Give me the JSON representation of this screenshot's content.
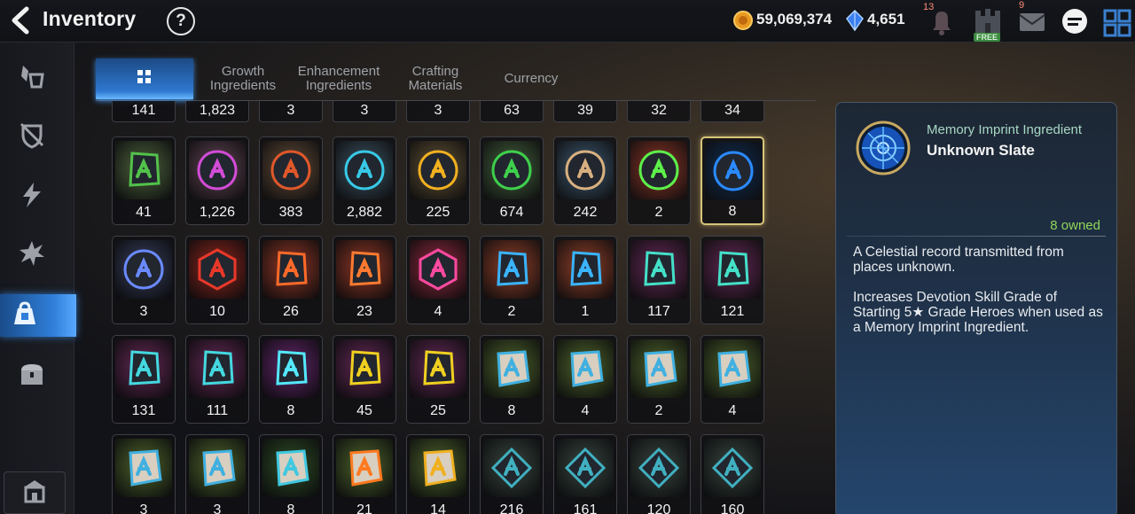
{
  "header": {
    "title": "Inventory",
    "help_icon": "question-mark-icon",
    "gold": "59,069,374",
    "crystals": "4,651",
    "notification_badge": "13",
    "mail_badge": "9",
    "free_label": "FREE"
  },
  "sidebar": {
    "items": [
      {
        "icon": "equipment-icon"
      },
      {
        "icon": "artifact-icon"
      },
      {
        "icon": "lightning-icon"
      },
      {
        "icon": "burst-icon"
      },
      {
        "icon": "materials-bag-icon",
        "active": true
      },
      {
        "icon": "chest-icon"
      }
    ],
    "bottom_icon": "shop-icon"
  },
  "tabs": [
    {
      "label": "",
      "icon": "grid-icon",
      "active": true
    },
    {
      "label": "Growth\nIngredients"
    },
    {
      "label": "Enhancement\nIngredients"
    },
    {
      "label": "Crafting\nMaterials"
    },
    {
      "label": "Currency"
    }
  ],
  "previous_row_counts": [
    "141",
    "1,823",
    "3",
    "3",
    "3",
    "63",
    "39",
    "32",
    "34"
  ],
  "rows": [
    [
      {
        "count": "41",
        "icon": "green-triangle-rune-icon",
        "bg": "#3a4a2f",
        "color": "#52c24a"
      },
      {
        "count": "1,226",
        "icon": "purple-gem-icon",
        "bg": "#4a3540",
        "color": "#d24cd6"
      },
      {
        "count": "383",
        "icon": "red-orange-gem-icon",
        "bg": "#4a3a2c",
        "color": "#e0582a"
      },
      {
        "count": "2,882",
        "icon": "cyan-gem-icon",
        "bg": "#2f3f4a",
        "color": "#37c9e6"
      },
      {
        "count": "225",
        "icon": "gold-gem-icon",
        "bg": "#4a3f2a",
        "color": "#f0b020"
      },
      {
        "count": "674",
        "icon": "green-gem-icon",
        "bg": "#344a30",
        "color": "#3ed04c"
      },
      {
        "count": "242",
        "icon": "feather-icon",
        "bg": "#304455",
        "color": "#d8b080"
      },
      {
        "count": "2",
        "icon": "green-orb-icon",
        "bg": "#6a2a20",
        "color": "#5ef04a"
      },
      {
        "count": "8",
        "icon": "unknown-slate-icon",
        "bg": "#0e2440",
        "color": "#2a8aff",
        "selected": true
      }
    ],
    [
      {
        "count": "3",
        "icon": "blue-crystal-orb-icon",
        "bg": "#2a2f44",
        "color": "#6a8aff"
      },
      {
        "count": "10",
        "icon": "red-hexagon-gem-icon",
        "bg": "#6a1e18",
        "color": "#e8382a"
      },
      {
        "count": "26",
        "icon": "red-t-rune-icon",
        "bg": "#6a2a1e",
        "color": "#ff6a2a"
      },
      {
        "count": "23",
        "icon": "red-slash-rune-icon",
        "bg": "#6a2a1e",
        "color": "#ff7a30"
      },
      {
        "count": "4",
        "icon": "pink-potion-icon",
        "bg": "#6a2030",
        "color": "#ff4aa0"
      },
      {
        "count": "2",
        "icon": "blue-catalyst-icon",
        "bg": "#6a3020",
        "color": "#3ab4ff"
      },
      {
        "count": "1",
        "icon": "blue-catalyst-2-icon",
        "bg": "#6a3020",
        "color": "#3ab4ff"
      },
      {
        "count": "117",
        "icon": "teal-slash-rune-icon",
        "bg": "#4a2040",
        "color": "#44e0c8"
      },
      {
        "count": "121",
        "icon": "teal-swirl-rune-icon",
        "bg": "#4a2040",
        "color": "#44e0c8"
      }
    ],
    [
      {
        "count": "131",
        "icon": "teal-rune-icon",
        "bg": "#4a2040",
        "color": "#44d8e0"
      },
      {
        "count": "111",
        "icon": "teal-rune-2-icon",
        "bg": "#4a2040",
        "color": "#44d8e0"
      },
      {
        "count": "8",
        "icon": "purple-star-rune-icon",
        "bg": "#4a1e50",
        "color": "#54e8ff"
      },
      {
        "count": "45",
        "icon": "gold-t-rune-icon",
        "bg": "#4a2040",
        "color": "#f0d020"
      },
      {
        "count": "25",
        "icon": "gold-slash-rune-icon",
        "bg": "#4a2040",
        "color": "#f0d020"
      },
      {
        "count": "8",
        "icon": "stone-rune-icon",
        "bg": "#3a4a22",
        "color": "#40b0e0"
      },
      {
        "count": "4",
        "icon": "stone-rune-2-icon",
        "bg": "#3a4a22",
        "color": "#40b0e0"
      },
      {
        "count": "2",
        "icon": "stone-rune-3-icon",
        "bg": "#3a4a22",
        "color": "#40b0e0"
      },
      {
        "count": "4",
        "icon": "stone-rune-4-icon",
        "bg": "#3a4a22",
        "color": "#40b0e0"
      }
    ],
    [
      {
        "count": "3",
        "icon": "stone-circle-rune-icon",
        "bg": "#3a4a22",
        "color": "#40b0e0"
      },
      {
        "count": "3",
        "icon": "stone-link-rune-icon",
        "bg": "#3a4a22",
        "color": "#40b0e0"
      },
      {
        "count": "8",
        "icon": "stone-star-rune-icon",
        "bg": "#243a1e",
        "color": "#40c8e0"
      },
      {
        "count": "21",
        "icon": "stone-red-t-rune-icon",
        "bg": "#3a4a22",
        "color": "#ff7a20"
      },
      {
        "count": "14",
        "icon": "stone-gold-slash-rune-icon",
        "bg": "#3a4a22",
        "color": "#f0b020"
      },
      {
        "count": "216",
        "icon": "diamond-slate-icon",
        "bg": "#2a3430",
        "color": "#40b0c0"
      },
      {
        "count": "161",
        "icon": "diamond-slate-2-icon",
        "bg": "#2a3430",
        "color": "#40b0c0"
      },
      {
        "count": "120",
        "icon": "diamond-slate-3-icon",
        "bg": "#2a3430",
        "color": "#40b0c0"
      },
      {
        "count": "160",
        "icon": "diamond-slate-4-icon",
        "bg": "#2a3430",
        "color": "#40b0c0"
      }
    ]
  ],
  "detail": {
    "category": "Memory Imprint Ingredient",
    "name": "Unknown Slate",
    "owned": "8 owned",
    "description": "A Celestial record transmitted from places unknown.",
    "effect": "Increases Devotion Skill Grade of Starting 5★ Grade Heroes when used as a Memory Imprint Ingredient."
  }
}
